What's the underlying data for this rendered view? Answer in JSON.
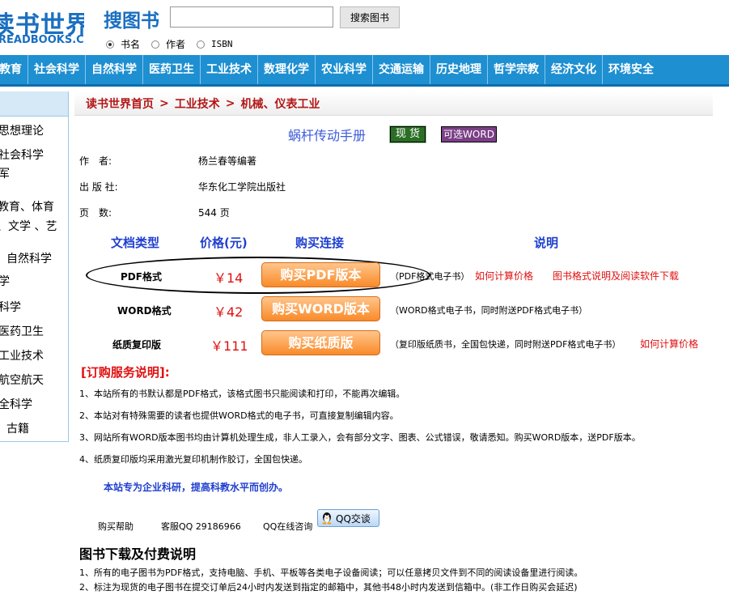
{
  "header": {
    "logo_big": "读书世界",
    "logo_small": "READBOOKS.CC",
    "search_title": "搜图书",
    "search_placeholder": "",
    "search_button": "搜索图书",
    "radios": [
      {
        "label": "书名",
        "checked": true
      },
      {
        "label": "作者",
        "checked": false
      },
      {
        "label": "ISBN",
        "checked": false
      }
    ]
  },
  "nav": {
    "items": [
      "文教育",
      "社会科学",
      "自然科学",
      "医药卫生",
      "工业技术",
      "数理化学",
      "农业科学",
      "交通运输",
      "历史地理",
      "哲学宗教",
      "经济文化",
      "环境安全"
    ]
  },
  "sidebar": {
    "items": [
      "思想理论",
      "社会科学",
      "军",
      "教育、体育",
      "、文学 、艺",
      "、自然科学",
      "学",
      "科学",
      "医药卫生",
      "工业技术",
      "航空航天",
      "全科学",
      "、古籍"
    ]
  },
  "breadcrumb": {
    "home": "读书世界首页",
    "sep": ">",
    "cat1": "工业技术",
    "cat2": "机械、仪表工业"
  },
  "book": {
    "title": "蜗杆传动手册",
    "tag_stock": "现 货",
    "tag_word": "可选WORD",
    "author_label": "作　者:",
    "author": "杨兰春等编著",
    "publisher_label": "出 版 社:",
    "publisher": "华东化工学院出版社",
    "pages_label": "页　数:",
    "pages": "544 页"
  },
  "purchase": {
    "headers": {
      "type": "文档类型",
      "price": "价格(元)",
      "link": "购买连接",
      "note": "说明"
    },
    "rows": [
      {
        "format": "PDF格式",
        "price": "￥14",
        "button": "购买PDF版本",
        "desc": "（PDF格式电子书）",
        "link1": "如何计算价格",
        "link2": "图书格式说明及阅读软件下载"
      },
      {
        "format": "WORD格式",
        "price": "￥42",
        "button": "购买WORD版本",
        "desc": "（WORD格式电子书，同时附送PDF格式电子书）"
      },
      {
        "format": "纸质复印版",
        "price": "￥111",
        "button": "购买纸质版",
        "desc": "（复印版纸质书，全国包快递，同时附送PDF格式电子书）",
        "link1": "如何计算价格"
      }
    ]
  },
  "service": {
    "title": "[订购服务说明]:",
    "notes": [
      "1、本站所有的书默认都是PDF格式，该格式图书只能阅读和打印，不能再次编辑。",
      "2、本站对有特殊需要的读者也提供WORD格式的电子书，可直接复制编辑内容。",
      "3、网站所有WORD版本图书均由计算机处理生成，非人工录入，会有部分文字、图表、公式错误，敬请悉知。购买WORD版本，送PDF版本。",
      "4、纸质复印版均采用激光复印机制作胶订，全国包快递。"
    ],
    "slogan": "本站专为企业科研，提高科教水平而创办。"
  },
  "help": {
    "buy_help": "购买帮助",
    "qq_service": "客服QQ 29186966",
    "qq_online": "QQ在线咨询",
    "qq_button": "QQ交谈"
  },
  "download": {
    "title": "图书下载及付费说明",
    "notes": [
      "1、所有的电子图书为PDF格式，支持电脑、手机、平板等各类电子设备阅读；可以任意拷贝文件到不同的阅读设备里进行阅读。",
      "2、标注为现货的电子图书在提交订单后24小时内发送到指定的邮箱中，其他书48小时内发送到信箱中。(非工作日购买会延迟)"
    ]
  },
  "colors": {
    "brand": "#1a6fc0",
    "nav": "#1e8fd1",
    "crumb": "#b31616",
    "price": "#e01010",
    "header_blue": "#1f3fcf",
    "button_orange": "#f98a2a"
  }
}
